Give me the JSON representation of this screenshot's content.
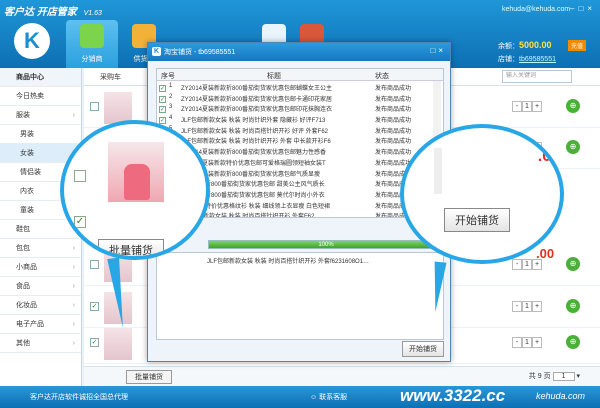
{
  "app": {
    "name": "客户达",
    "title": "开店管家",
    "version": "V1.63"
  },
  "nav": [
    {
      "label": "分销商"
    },
    {
      "label": "供货商"
    }
  ],
  "account": {
    "email": "kehuda@kehuda.com",
    "balance_label": "余额：",
    "balance": "5000.00",
    "recharge_label": "充值",
    "store_label": "店铺：",
    "store": "tb69585551"
  },
  "sidebar": {
    "header": "商品中心",
    "items": [
      {
        "label": "今日热卖",
        "icon": "clock-icon"
      },
      {
        "label": "服装",
        "icon": "shirt-icon"
      },
      {
        "label": "男装"
      },
      {
        "label": "女装"
      },
      {
        "label": "情侣装"
      },
      {
        "label": "内衣"
      },
      {
        "label": "童装"
      },
      {
        "label": "鞋包"
      },
      {
        "label": "包包"
      },
      {
        "label": "小商品"
      },
      {
        "label": "食品"
      },
      {
        "label": "化妆品"
      },
      {
        "label": "电子产品"
      },
      {
        "label": "其他"
      }
    ]
  },
  "main": {
    "category_dropdown": "采购车",
    "search_placeholder": "输入关键词",
    "qty_default": "1",
    "price_fragment": ".00"
  },
  "dialog": {
    "title": "淘宝铺货 - tb69585551",
    "columns": [
      "序号",
      "标题",
      "状态"
    ],
    "rows": [
      {
        "num": "1",
        "title": "ZY2014夏装新款折800番茄街货家优惠包邮蝴蝶女王公主",
        "status": "发布商品成功"
      },
      {
        "num": "2",
        "title": "ZY2014夏装新款折800番茄街货家优惠包邮卡通印花家居",
        "status": "发布商品成功"
      },
      {
        "num": "3",
        "title": "ZY2014夏装新款折800番茄街货家优惠包邮印花抹胸连衣",
        "status": "发布商品成功"
      },
      {
        "num": "4",
        "title": "JLF包邮新款女装 秋装 时尚针织外套 隐藏衫 好评F713",
        "status": "发布商品成功"
      },
      {
        "num": "5",
        "title": "JLF包邮新款女装 秋装 时尚百搭针织开衫 好评 外套F62",
        "status": "发布商品成功"
      },
      {
        "num": "6",
        "title": "JLF包邮新款女装 秋装 时尚针织开衫 外套 中长款开衫F6",
        "status": "发布商品成功"
      },
      {
        "num": "7",
        "title": "ZY2014夏装新款折800番茄街货家优惠包邮魅力性感香",
        "status": "发布商品成功"
      },
      {
        "num": "",
        "title": "ZY2014夏装新款特价优惠包邮可爱格瑞圆领短袖女装T",
        "status": "发布商品成功"
      },
      {
        "num": "",
        "title": "ZY2014夏装新款折800番茄街货家优惠包邮气质显瘦",
        "status": "发布商品成功"
      },
      {
        "num": "",
        "title": "新款新款折800番茄街货家优惠包邮 甜美公主风气质长",
        "status": "发布商品成功"
      },
      {
        "num": "",
        "title": "新款新款折800番茄街货家优惠包邮 莫代尔时尚小外衣",
        "status": "发布商品成功"
      },
      {
        "num": "",
        "title": "新款新款特价优惠格纹衫 秋装 细线领上衣显瘦 白色短裙",
        "status": "发布商品成功"
      },
      {
        "num": "",
        "title": "JLF包邮新款女装 秋装 时尚百搭针织开衫 外套F62",
        "status": "发布商品成功"
      }
    ],
    "progress_pct": 1.0,
    "progress_label": "100%",
    "log_line": "JLF包邮新款女装 秋装 时尚百搭针织开衫 外套f6231608O1…",
    "start_button": "开始铺货"
  },
  "callouts": {
    "bulk_button": "批量铺货",
    "start_button": "开始铺货"
  },
  "footer": {
    "bulk_button": "批量铺货",
    "pager_prefix": "共",
    "pager_total": "9",
    "pager_suffix": "页",
    "page_value": "1",
    "status_message": "客户达开店软件诚招全国总代理",
    "service_link": "联系客服",
    "website": "www.3322.cc",
    "site_name": "kehuda.com"
  },
  "colors": {
    "accent": "#1a8fd3",
    "success": "#4caf3a",
    "price": "#e03020",
    "callout_ring": "#29a6e6"
  }
}
